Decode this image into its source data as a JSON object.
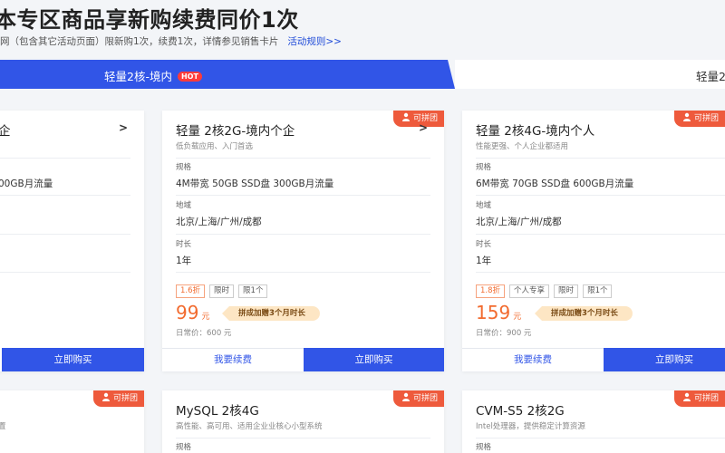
{
  "header": {
    "title": "本专区商品享新购续费同价1次",
    "subtitle": "网（包含其它活动页面）限新购1次，续费1次，详情参见销售卡片",
    "rules_link": "活动规则>>"
  },
  "tabs": [
    {
      "label": "轻量2核-境内",
      "badge": "HOT",
      "active": true
    },
    {
      "label": "轻量2",
      "active": false
    }
  ],
  "labels": {
    "spec": "规格",
    "region": "地域",
    "duration": "时长",
    "currency": "元",
    "renew": "我要续费",
    "buy": "立即购买",
    "group": "可拼团",
    "promo": "拼成加赠3个月时长"
  },
  "cards": [
    {
      "title": "企",
      "spec": "00GB月流量"
    },
    {
      "title": "轻量 2核2G-境内个企",
      "desc": "低负载应用、入门首选",
      "spec": "4M带宽 50GB SSD盘 300GB月流量",
      "region": "北京/上海/广州/成都",
      "duration": "1年",
      "tags": [
        "1.6折",
        "限时",
        "限1个"
      ],
      "price": "99",
      "original": "日常价：600 元"
    },
    {
      "title": "轻量 2核4G-境内个人",
      "desc": "性能更强、个人企业都适用",
      "spec": "6M带宽 70GB SSD盘 600GB月流量",
      "region": "北京/上海/广州/成都",
      "duration": "1年",
      "tags": [
        "1.8折",
        "个人专享",
        "限时",
        "限1个"
      ],
      "price": "159",
      "original": "日常价：900 元"
    }
  ],
  "bottom_cards": [
    {
      "title": "",
      "desc": "置"
    },
    {
      "title": "MySQL 2核4G",
      "desc": "高性能、高可用、适用企业业核心小型系统",
      "spec_label": "规格"
    },
    {
      "title": "CVM-S5 2核2G",
      "desc": "Intel处理器，提供稳定计算资源",
      "spec_label": "规格"
    }
  ],
  "colors": {
    "primary": "#3155e7",
    "accent": "#f26b2f",
    "badge": "#ee5a3c"
  }
}
